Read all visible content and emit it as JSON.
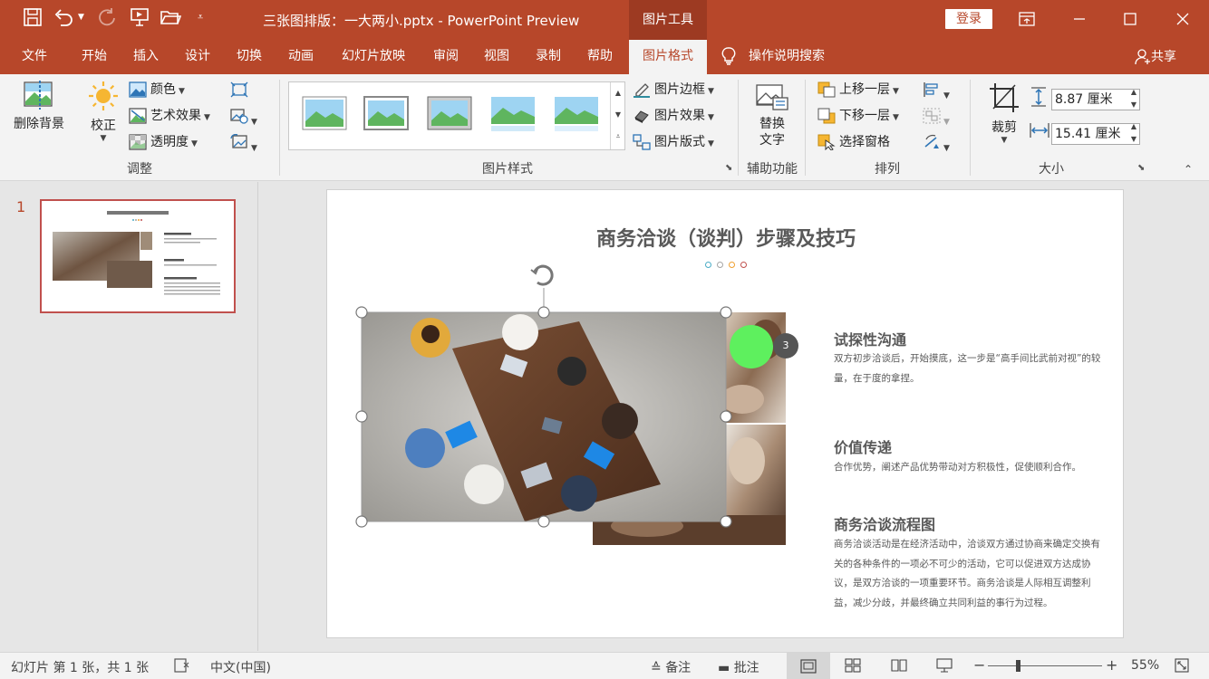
{
  "titlebar": {
    "doc_title": "三张图排版：一大两小.pptx  -  PowerPoint Preview",
    "context_group": "图片工具",
    "login": "登录"
  },
  "tabs": [
    "文件",
    "开始",
    "插入",
    "设计",
    "切换",
    "动画",
    "幻灯片放映",
    "审阅",
    "视图",
    "录制",
    "帮助",
    "图片格式"
  ],
  "active_tab": "图片格式",
  "tell_me": "操作说明搜索",
  "share": "共享",
  "ribbon": {
    "adjust": {
      "remove_bg": "删除背景",
      "correct": "校正",
      "color": "颜色",
      "artistic": "艺术效果",
      "transparency": "透明度",
      "group_label": "调整"
    },
    "styles": {
      "border": "图片边框",
      "effects": "图片效果",
      "layout": "图片版式",
      "group_label": "图片样式"
    },
    "accessibility": {
      "alt_text_line1": "替换",
      "alt_text_line2": "文字",
      "group_label": "辅助功能"
    },
    "arrange": {
      "bring_forward": "上移一层",
      "send_backward": "下移一层",
      "selection_pane": "选择窗格",
      "group_label": "排列"
    },
    "size": {
      "crop": "裁剪",
      "height": "8.87 厘米",
      "width": "15.41 厘米",
      "group_label": "大小"
    }
  },
  "thumbnail": {
    "number": "1"
  },
  "slide": {
    "title": "商务洽谈（谈判）步骤及技巧",
    "dot_colors": [
      "#4bacc6",
      "#a5a5a5",
      "#f0a030",
      "#c0504d"
    ],
    "badge": "3",
    "sections": [
      {
        "title": "试探性沟通",
        "text": "双方初步洽谈后，开始摸底，这一步是“高手间比武前对视”的较量，在于度的拿捏。"
      },
      {
        "title": "价值传递",
        "text": "合作优势，阐述产品优势带动对方积极性，促使顺利合作。"
      },
      {
        "title": "商务洽谈流程图",
        "text": "商务洽谈活动是在经济活动中，洽谈双方通过协商来确定交换有关的各种条件的一项必不可少的活动，它可以促进双方达成协议，是双方洽谈的一项重要环节。商务洽谈是人际相互调整利益，减少分歧，并最终确立共同利益的事行为过程。"
      }
    ]
  },
  "statusbar": {
    "slide_info": "幻灯片 第 1 张，共 1 张",
    "language": "中文(中国)",
    "notes": "备注",
    "comments": "批注",
    "zoom": "55%"
  },
  "colors": {
    "accent": "#b7472a",
    "ribbon_bg": "#f3f3f3",
    "green_marker": "#5ef05e"
  }
}
